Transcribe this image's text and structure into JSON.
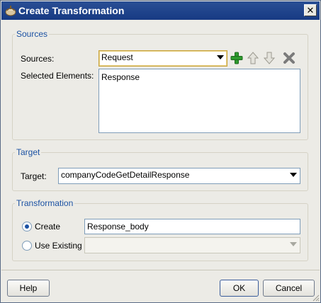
{
  "window": {
    "title": "Create Transformation",
    "close_glyph": "✕"
  },
  "sources": {
    "section_title": "Sources",
    "sources_label": "Sources:",
    "sources_value": "Request",
    "selected_elements_label": "Selected Elements:",
    "selected_elements": [
      "Response"
    ],
    "icons": [
      "add-icon",
      "move-up-icon",
      "move-down-icon",
      "delete-icon"
    ]
  },
  "target": {
    "section_title": "Target",
    "target_label": "Target:",
    "target_value": "companyCodeGetDetailResponse"
  },
  "transformation": {
    "section_title": "Transformation",
    "create_label": "Create",
    "create_value": "Response_body",
    "use_existing_label": "Use Existing",
    "use_existing_value": "",
    "selected_option": "Create"
  },
  "buttons": {
    "help": "Help",
    "ok": "OK",
    "cancel": "Cancel"
  },
  "colors": {
    "title_bar": "#173a83",
    "section_title": "#1c52a3",
    "add_icon": "#2e9a2e",
    "delete_icon": "#7b7b7b"
  }
}
